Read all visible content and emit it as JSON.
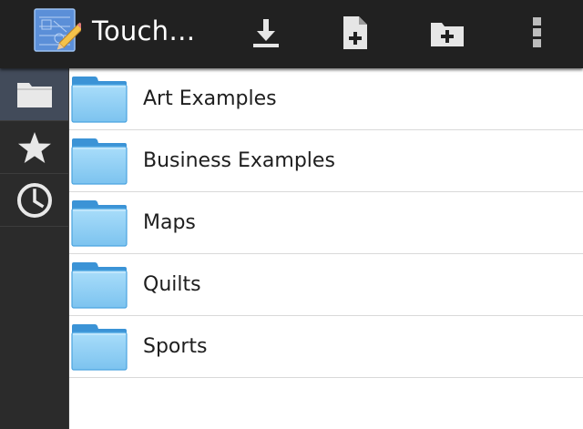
{
  "action_bar": {
    "app_icon": "app-blueprint-pencil-icon",
    "title": "Touch…",
    "buttons": [
      {
        "name": "download-button",
        "icon": "download-icon"
      },
      {
        "name": "new-file-button",
        "icon": "new-file-icon"
      },
      {
        "name": "new-folder-button",
        "icon": "new-folder-icon"
      },
      {
        "name": "overflow-menu-button",
        "icon": "overflow-menu-icon"
      }
    ]
  },
  "sidebar": {
    "items": [
      {
        "icon": "folder-icon",
        "selected": true
      },
      {
        "icon": "star-icon",
        "selected": false
      },
      {
        "icon": "clock-icon",
        "selected": false
      }
    ]
  },
  "folders": [
    {
      "name": "Art Examples"
    },
    {
      "name": "Business Examples"
    },
    {
      "name": "Maps"
    },
    {
      "name": "Quilts"
    },
    {
      "name": "Sports"
    }
  ],
  "colors": {
    "action_bar_bg": "#212121",
    "sidebar_bg": "#2b2b2b",
    "sidebar_selected": "#424b5a",
    "folder_blue": "#8fd0f5",
    "folder_tab": "#3b93d6"
  }
}
